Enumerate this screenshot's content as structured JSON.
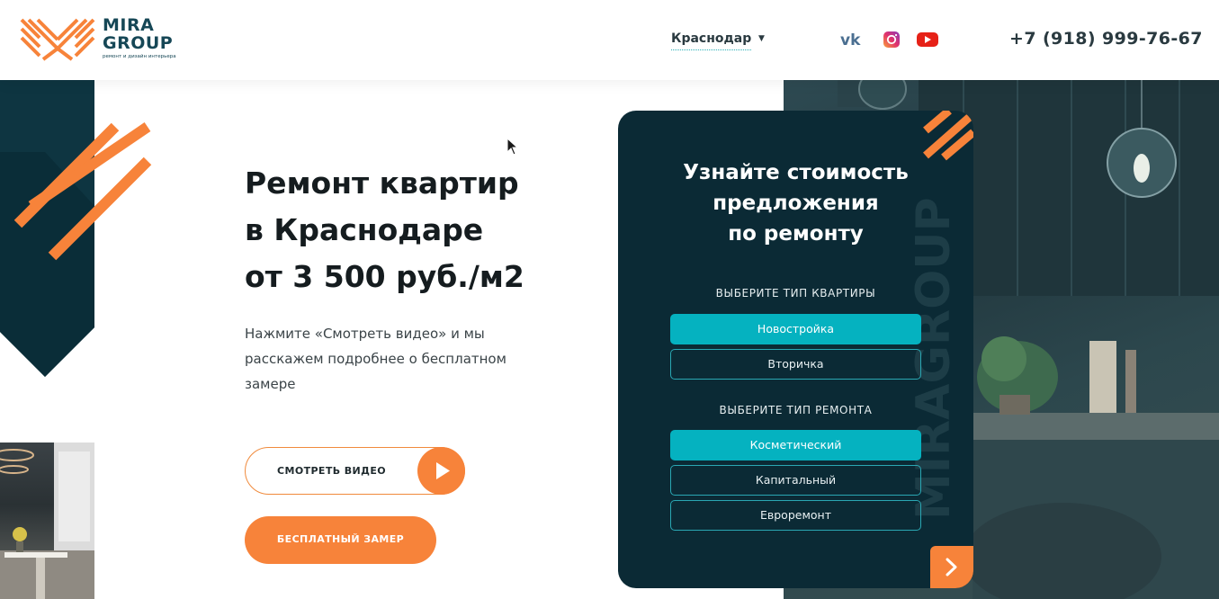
{
  "header": {
    "logo_name_line1": "MIRA",
    "logo_name_line2": "GROUP",
    "logo_tagline": "ремонт и дизайн интерьера",
    "city": "Краснодар",
    "phone": "+7 (918) 999-76-67",
    "social": [
      "vk-icon",
      "instagram-icon",
      "youtube-icon"
    ]
  },
  "hero": {
    "title_lines": [
      "Ремонт квартир",
      "в Краснодаре",
      "от 3 500 руб./м2"
    ],
    "description": "Нажмите «Смотреть видео» и мы расскажем подробнее о бесплатном замере",
    "video_button": "СМОТРЕТЬ ВИДЕО",
    "free_button": "БЕСПЛАТНЫЙ ЗАМЕР"
  },
  "quiz": {
    "title_lines": [
      "Узнайте стоимость",
      "предложения",
      "по ремонту"
    ],
    "watermark": "MIRAGROUP",
    "apartment_label": "ВЫБЕРИТЕ ТИП КВАРТИРЫ",
    "apartment_options": [
      "Новостройка",
      "Вторичка"
    ],
    "apartment_selected": "Новостройка",
    "repair_label": "ВЫБЕРИТЕ ТИП РЕМОНТА",
    "repair_options": [
      "Косметический",
      "Капитальный",
      "Евроремонт"
    ],
    "repair_selected": "Косметический"
  },
  "colors": {
    "accent_orange": "#f7833a",
    "accent_teal": "#05b2c0",
    "dark_teal": "#0b2a35",
    "brand_text": "#164756"
  }
}
